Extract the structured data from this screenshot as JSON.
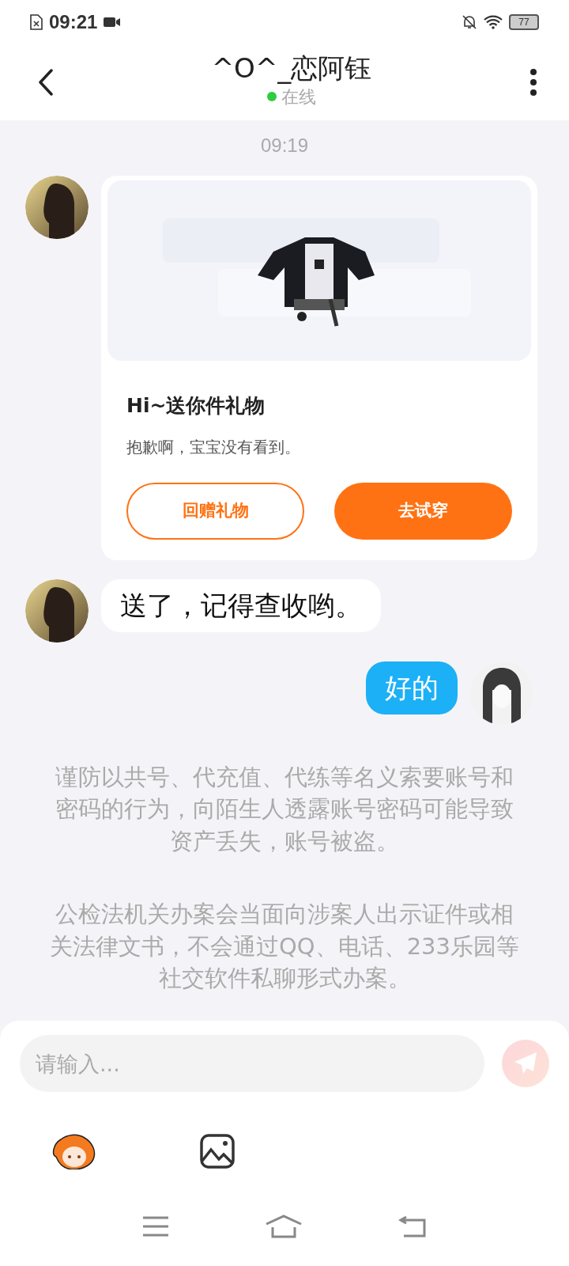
{
  "status_bar": {
    "time": "09:21",
    "battery": "77"
  },
  "header": {
    "title": "^O^_恋阿钰",
    "status": "在线",
    "online": true
  },
  "timestamp": "09:19",
  "messages": [
    {
      "kind": "gift",
      "outgoing": false,
      "title": "Hi~送你件礼物",
      "text": "抱歉啊，宝宝没有看到。",
      "buttons": [
        {
          "label": "回赠礼物",
          "kind": "outline"
        },
        {
          "label": "去试穿",
          "kind": "solid"
        }
      ]
    },
    {
      "kind": "text",
      "outgoing": false,
      "text": "送了，记得查收哟。"
    },
    {
      "kind": "text",
      "outgoing": true,
      "text": "好的"
    }
  ],
  "notices": [
    "谨防以共号、代充值、代练等名义索要账号和密码的行为，向陌生人透露账号密码可能导致资产丢失，账号被盗。",
    "公检法机关办案会当面向涉案人出示证件或相关法律文书，不会通过QQ、电话、233乐园等社交软件私聊形式办案。"
  ],
  "composer": {
    "placeholder": "请输入...",
    "send_enabled": false
  }
}
